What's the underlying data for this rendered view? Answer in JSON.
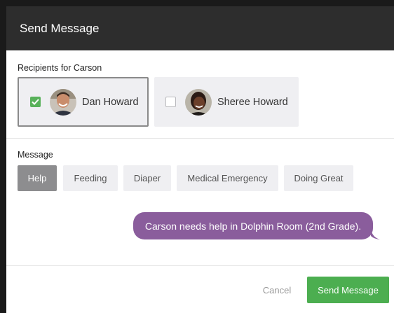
{
  "header": {
    "title": "Send Message"
  },
  "recipients": {
    "label": "Recipients for Carson",
    "items": [
      {
        "name": "Dan Howard",
        "checked": true
      },
      {
        "name": "Sheree Howard",
        "checked": false
      }
    ]
  },
  "message": {
    "label": "Message",
    "tags": [
      {
        "label": "Help",
        "active": true
      },
      {
        "label": "Feeding",
        "active": false
      },
      {
        "label": "Diaper",
        "active": false
      },
      {
        "label": "Medical Emergency",
        "active": false
      },
      {
        "label": "Doing Great",
        "active": false
      }
    ],
    "preview": "Carson needs help in Dolphin Room (2nd Grade)."
  },
  "footer": {
    "cancel_label": "Cancel",
    "send_label": "Send Message"
  },
  "colors": {
    "header_bg": "#2d2d2d",
    "checkbox_checked": "#58b15a",
    "bubble": "#8a5d9c",
    "send_button": "#4cae50",
    "active_tag": "#8d8d8f"
  },
  "icons": [
    "check-icon",
    "avatar-dan-howard",
    "avatar-sheree-howard"
  ]
}
